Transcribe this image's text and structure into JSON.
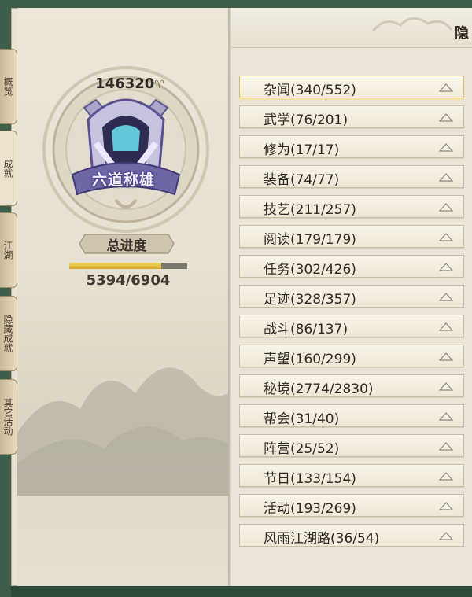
{
  "header": {
    "title": "隐"
  },
  "side_tabs": [
    {
      "label": "概览",
      "active": false
    },
    {
      "label": "成就",
      "active": true
    },
    {
      "label": "江湖",
      "active": false
    },
    {
      "label": "隐藏成就",
      "active": false
    },
    {
      "label": "其它活动",
      "active": false
    }
  ],
  "summary": {
    "score": "146320",
    "score_icon": "trophy-icon",
    "badge_title": "六道称雄",
    "progress_title": "总进度",
    "progress_text": "5394/6904",
    "progress_fraction": 0.781
  },
  "categories": [
    {
      "label": "杂闻(340/552)",
      "selected": true
    },
    {
      "label": "武学(76/201)",
      "selected": false
    },
    {
      "label": "修为(17/17)",
      "selected": false
    },
    {
      "label": "装备(74/77)",
      "selected": false
    },
    {
      "label": "技艺(211/257)",
      "selected": false
    },
    {
      "label": "阅读(179/179)",
      "selected": false
    },
    {
      "label": "任务(302/426)",
      "selected": false
    },
    {
      "label": "足迹(328/357)",
      "selected": false
    },
    {
      "label": "战斗(86/137)",
      "selected": false
    },
    {
      "label": "声望(160/299)",
      "selected": false
    },
    {
      "label": "秘境(2774/2830)",
      "selected": false
    },
    {
      "label": "帮会(31/40)",
      "selected": false
    },
    {
      "label": "阵营(25/52)",
      "selected": false
    },
    {
      "label": "节日(133/154)",
      "selected": false
    },
    {
      "label": "活动(193/269)",
      "selected": false
    },
    {
      "label": "风雨江湖路(36/54)",
      "selected": false
    }
  ],
  "colors": {
    "progress_fill": "#e2b838",
    "selected_border": "#d6bf5f",
    "panel_bg": "#eae5d8"
  }
}
